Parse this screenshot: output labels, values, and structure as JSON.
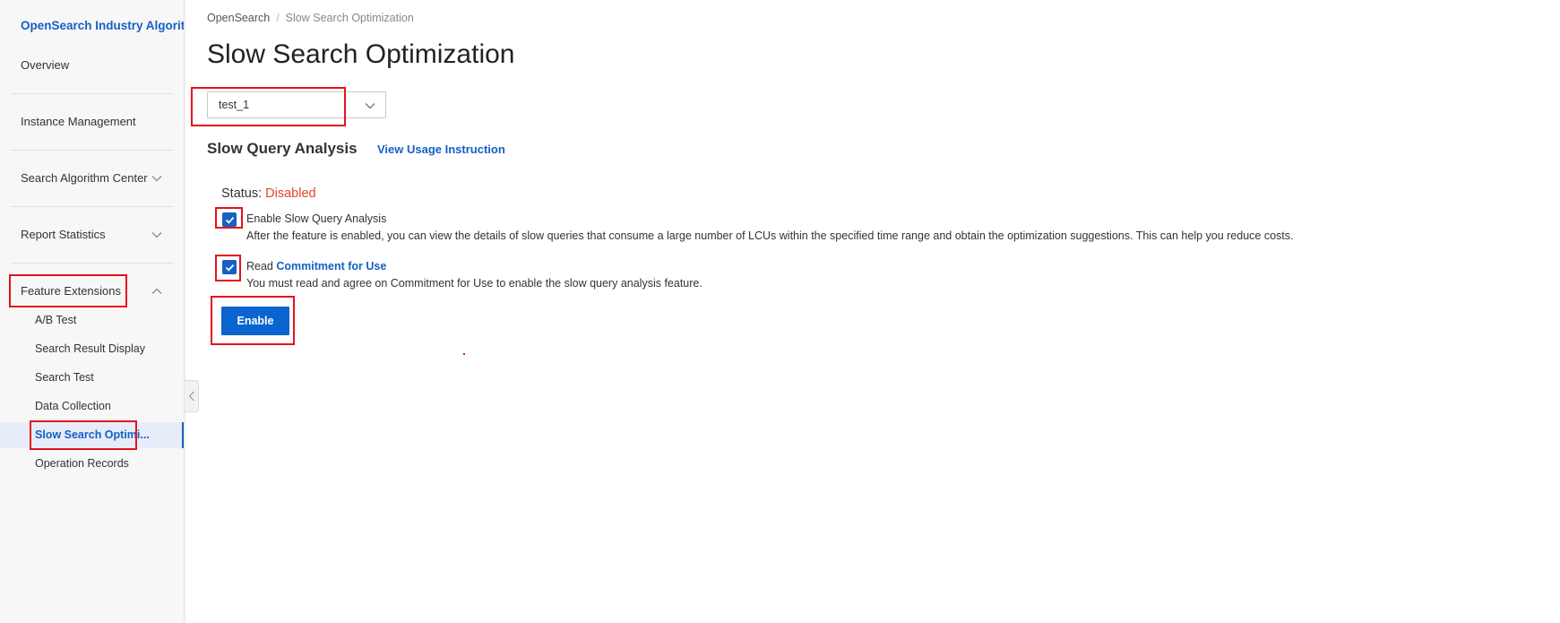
{
  "sidebar": {
    "title": "OpenSearch Industry Algorithm",
    "items": [
      {
        "label": "Overview"
      },
      {
        "label": "Instance Management"
      },
      {
        "label": "Search Algorithm Center"
      },
      {
        "label": "Report Statistics"
      },
      {
        "label": "Feature Extensions"
      }
    ],
    "subitems": [
      {
        "label": "A/B Test"
      },
      {
        "label": "Search Result Display"
      },
      {
        "label": "Search Test"
      },
      {
        "label": "Data Collection"
      },
      {
        "label": "Slow Search Optimi..."
      },
      {
        "label": "Operation Records"
      }
    ],
    "active_color": "#1560c4"
  },
  "breadcrumb": {
    "items": [
      "OpenSearch",
      "Slow Search Optimization"
    ],
    "separator": "/"
  },
  "page": {
    "title": "Slow Search Optimization"
  },
  "instance_select": {
    "value": "test_1"
  },
  "section": {
    "title": "Slow Query Analysis",
    "usage_link": "View Usage Instruction"
  },
  "status": {
    "label": "Status:",
    "value": "Disabled",
    "color": "#e0452e"
  },
  "options": {
    "enable": {
      "checked": true,
      "label": "Enable Slow Query Analysis",
      "description": "After the feature is enabled, you can view the details of slow queries that consume a large number of LCUs within the specified time range and obtain the optimization suggestions. This can help you reduce costs."
    },
    "commitment": {
      "checked": true,
      "label_prefix": "Read",
      "link": "Commitment for Use",
      "description": "You must read and agree on Commitment for Use to enable the slow query analysis feature."
    }
  },
  "enable_button": {
    "label": "Enable",
    "color": "#0a64cf"
  },
  "annotation_color": "#e8101f"
}
